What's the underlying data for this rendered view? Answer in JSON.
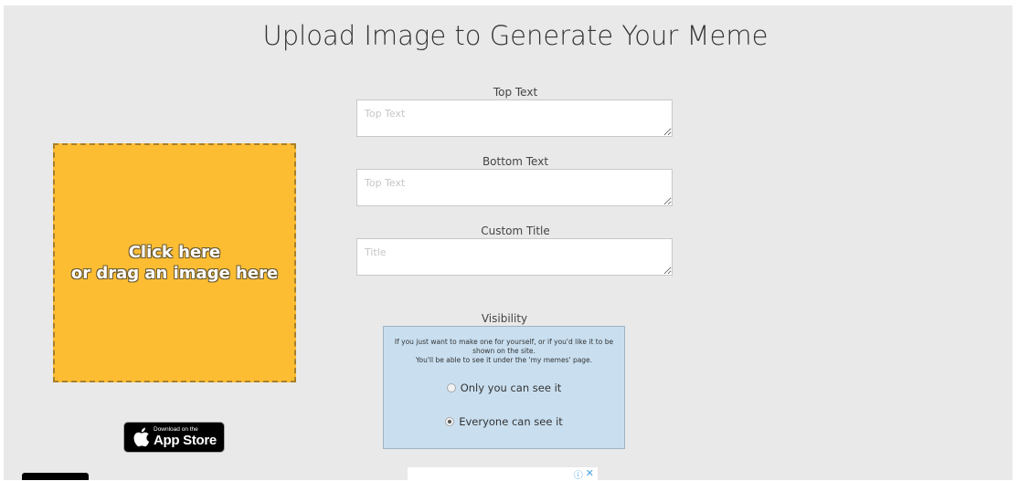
{
  "page": {
    "title": "Upload Image to Generate Your Meme"
  },
  "upload": {
    "line1": "Click here",
    "line2": "or drag an image here"
  },
  "fields": {
    "top_text": {
      "label": "Top Text",
      "placeholder": "Top Text",
      "value": ""
    },
    "bottom_text": {
      "label": "Bottom Text",
      "placeholder": "Top Text",
      "value": ""
    },
    "custom_title": {
      "label": "Custom Title",
      "placeholder": "Title",
      "value": ""
    }
  },
  "visibility": {
    "label": "Visibility",
    "info_line1": "If you just want to make one for yourself, or if you'd like it to be shown on the site.",
    "info_line2": "You'll be able to see it under the 'my memes' page.",
    "options": [
      {
        "label": "Only you can see it",
        "selected": false
      },
      {
        "label": "Everyone can see it",
        "selected": true
      }
    ]
  },
  "app_store": {
    "small_text": "Download on the",
    "big_text": "App Store",
    "icon": "apple-icon"
  },
  "ad": {
    "info_icon": "ⓘ",
    "close_icon": "✕"
  },
  "colors": {
    "panel_bg": "#e9e9e9",
    "upload_bg": "#fdbd33",
    "visibility_bg": "#c9dff0"
  }
}
